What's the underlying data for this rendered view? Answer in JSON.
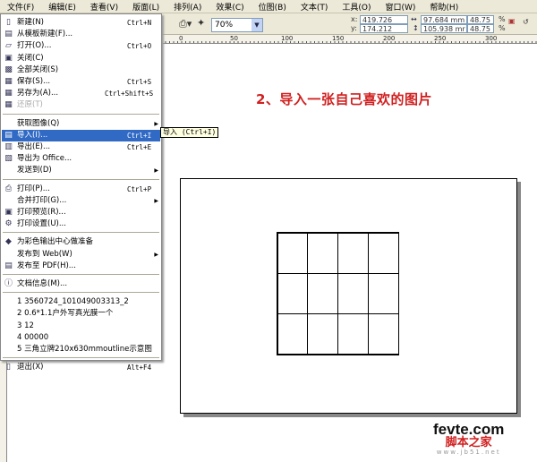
{
  "menubar": [
    "文件(F)",
    "编辑(E)",
    "查看(V)",
    "版面(L)",
    "排列(A)",
    "效果(C)",
    "位图(B)",
    "文本(T)",
    "工具(O)",
    "窗口(W)",
    "帮助(H)"
  ],
  "toolbar": {
    "zoom": "70%",
    "x": "419.726 mm",
    "y": "174.212 mm",
    "x_label": "x:",
    "y_label": "y:",
    "width": "97.684 mm",
    "height": "105.938 mr",
    "scale_w": "48.75",
    "scale_h": "48.75",
    "percent": "%"
  },
  "ruler": [
    "0",
    "50",
    "100",
    "150",
    "200",
    "250",
    "300"
  ],
  "file_menu": [
    {
      "icon": "new-icon",
      "glyph": "▯",
      "label": "新建(N)",
      "shortcut": "Ctrl+N"
    },
    {
      "icon": "template-icon",
      "glyph": "▤",
      "label": "从模板新建(F)..."
    },
    {
      "icon": "open-icon",
      "glyph": "▱",
      "label": "打开(O)...",
      "shortcut": "Ctrl+O"
    },
    {
      "icon": "close-icon",
      "glyph": "▣",
      "label": "关闭(C)"
    },
    {
      "icon": "close-all-icon",
      "glyph": "▩",
      "label": "全部关闭(S)"
    },
    {
      "icon": "save-icon",
      "glyph": "▦",
      "label": "保存(S)...",
      "shortcut": "Ctrl+S"
    },
    {
      "icon": "save-as-icon",
      "glyph": "▦",
      "label": "另存为(A)...",
      "shortcut": "Ctrl+Shift+S"
    },
    {
      "icon": "revert-icon",
      "glyph": "▦",
      "label": "还原(T)",
      "disabled": true
    },
    {
      "sep": true
    },
    {
      "label": "获取图像(Q)",
      "submenu": true
    },
    {
      "icon": "import-icon",
      "glyph": "▤",
      "label": "导入(I)...",
      "shortcut": "Ctrl+I",
      "highlighted": true
    },
    {
      "icon": "export-icon",
      "glyph": "▥",
      "label": "导出(E)...",
      "shortcut": "Ctrl+E"
    },
    {
      "icon": "export-office-icon",
      "glyph": "▧",
      "label": "导出为 Office..."
    },
    {
      "label": "发送到(D)",
      "submenu": true
    },
    {
      "sep": true
    },
    {
      "icon": "print-icon",
      "glyph": "⎙",
      "label": "打印(P)...",
      "shortcut": "Ctrl+P"
    },
    {
      "label": "合并打印(G)...",
      "submenu": true
    },
    {
      "icon": "print-preview-icon",
      "glyph": "▣",
      "label": "打印预览(R)..."
    },
    {
      "icon": "print-setup-icon",
      "glyph": "⚙",
      "label": "打印设置(U)..."
    },
    {
      "sep": true
    },
    {
      "icon": "prepress-icon",
      "glyph": "◆",
      "label": "为彩色输出中心做准备"
    },
    {
      "label": "发布到 Web(W)",
      "submenu": true
    },
    {
      "icon": "pdf-icon",
      "glyph": "▤",
      "label": "发布至 PDF(H)..."
    },
    {
      "sep": true
    },
    {
      "icon": "info-icon",
      "glyph": "ⓘ",
      "label": "文档信息(M)..."
    },
    {
      "sep": true
    },
    {
      "label": "1 3560724_101049003313_2"
    },
    {
      "label": "2 0.6*1.1户外写真光膜一个"
    },
    {
      "label": "3 12"
    },
    {
      "label": "4 00000"
    },
    {
      "label": "5 三角立牌210x630mmoutline示意图"
    },
    {
      "sep": true
    },
    {
      "icon": "exit-icon",
      "glyph": "▯",
      "label": "退出(X)",
      "shortcut": "Alt+F4"
    }
  ],
  "tooltip": "导入 (Ctrl+I)",
  "heading": "2、导入一张自己喜欢的图片",
  "watermark": {
    "a": "fevte.com",
    "b": "脚本之家",
    "c": "www.jb51.net"
  }
}
